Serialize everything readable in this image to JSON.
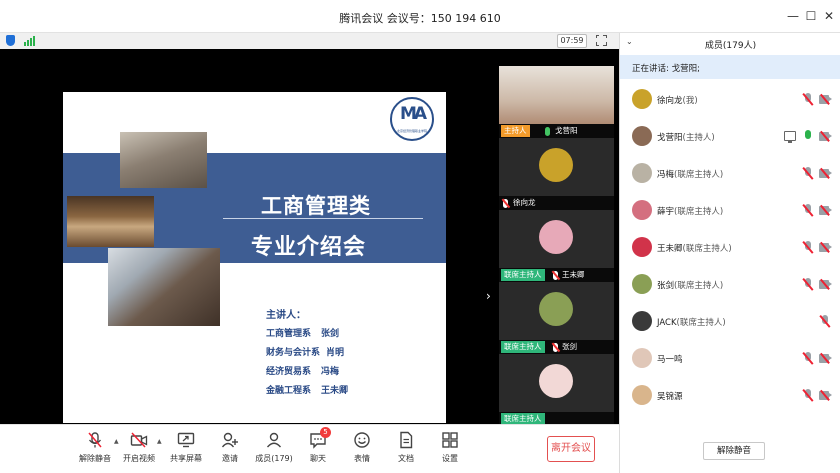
{
  "window": {
    "title": "腾讯会议 会议号：150 194 610"
  },
  "status": {
    "timer": "07:59"
  },
  "slide": {
    "logo_mark": "MA",
    "logo_sub": "北京经济管理职业学院",
    "line1": "工商管理类",
    "line2": "专业介绍会",
    "speakers_heading": "主讲人：",
    "speakers": [
      {
        "dept": "工商管理系",
        "name": "张剑"
      },
      {
        "dept": "财务与会计系",
        "name": "肖明"
      },
      {
        "dept": "经济贸易系",
        "name": "冯梅"
      },
      {
        "dept": "金融工程系",
        "name": "王未卿"
      }
    ]
  },
  "video_tiles": [
    {
      "tag": "主持人",
      "name": "戈营阳",
      "mic": "on",
      "face": "#c79c84"
    },
    {
      "tag": "",
      "name": "徐向龙",
      "mic": "off",
      "face": "#c9a22a"
    },
    {
      "tag": "联席主持人",
      "name": "王未卿",
      "mic": "off",
      "face": "#e7a9b8"
    },
    {
      "tag": "联席主持人",
      "name": "张剑",
      "mic": "off",
      "face": "#8a9f55"
    },
    {
      "tag": "联席主持人",
      "name": "",
      "mic": "off",
      "face": "#f2d8d6"
    }
  ],
  "toolbar": {
    "items": [
      {
        "label": "解除静音",
        "icon": "muted-mic-icon"
      },
      {
        "label": "开启视频",
        "icon": "video-off-icon"
      },
      {
        "label": "共享屏幕",
        "icon": "share-screen-icon"
      },
      {
        "label": "邀请",
        "icon": "invite-icon"
      },
      {
        "label": "成员(179)",
        "icon": "members-icon"
      },
      {
        "label": "聊天",
        "icon": "chat-icon"
      },
      {
        "label": "表情",
        "icon": "emoji-icon"
      },
      {
        "label": "文档",
        "icon": "document-icon"
      },
      {
        "label": "设置",
        "icon": "settings-icon"
      }
    ],
    "chat_badge": "5",
    "leave": "离开会议"
  },
  "panel": {
    "title": "成员(179人)",
    "speaking": "正在讲话: 戈营阳;",
    "unmute_all": "解除静音",
    "members": [
      {
        "name": "徐向龙",
        "role": "(我)",
        "avatar": "#c9a22a",
        "mic": "off",
        "cam": true,
        "share": false
      },
      {
        "name": "戈营阳",
        "role": "(主持人)",
        "avatar": "#8a6a55",
        "mic": "on",
        "cam": true,
        "share": true
      },
      {
        "name": "冯梅",
        "role": "(联席主持人)",
        "avatar": "#b9b2a4",
        "mic": "off",
        "cam": true,
        "share": false
      },
      {
        "name": "薛宇",
        "role": "(联席主持人)",
        "avatar": "#d46f7f",
        "mic": "off",
        "cam": true,
        "share": false
      },
      {
        "name": "王未卿",
        "role": "(联席主持人)",
        "avatar": "#d1334a",
        "mic": "off",
        "cam": true,
        "share": false
      },
      {
        "name": "张剑",
        "role": "(联席主持人)",
        "avatar": "#8a9f55",
        "mic": "off",
        "cam": true,
        "share": false
      },
      {
        "name": "JACK",
        "role": "(联席主持人)",
        "avatar": "#3a3a3a",
        "mic": "off",
        "cam": false,
        "share": false
      },
      {
        "name": "马一鸣",
        "role": "",
        "avatar": "#e0c7b8",
        "mic": "off",
        "cam": true,
        "share": false
      },
      {
        "name": "吴锦源",
        "role": "",
        "avatar": "#d9b58c",
        "mic": "off",
        "cam": true,
        "share": false
      }
    ]
  }
}
